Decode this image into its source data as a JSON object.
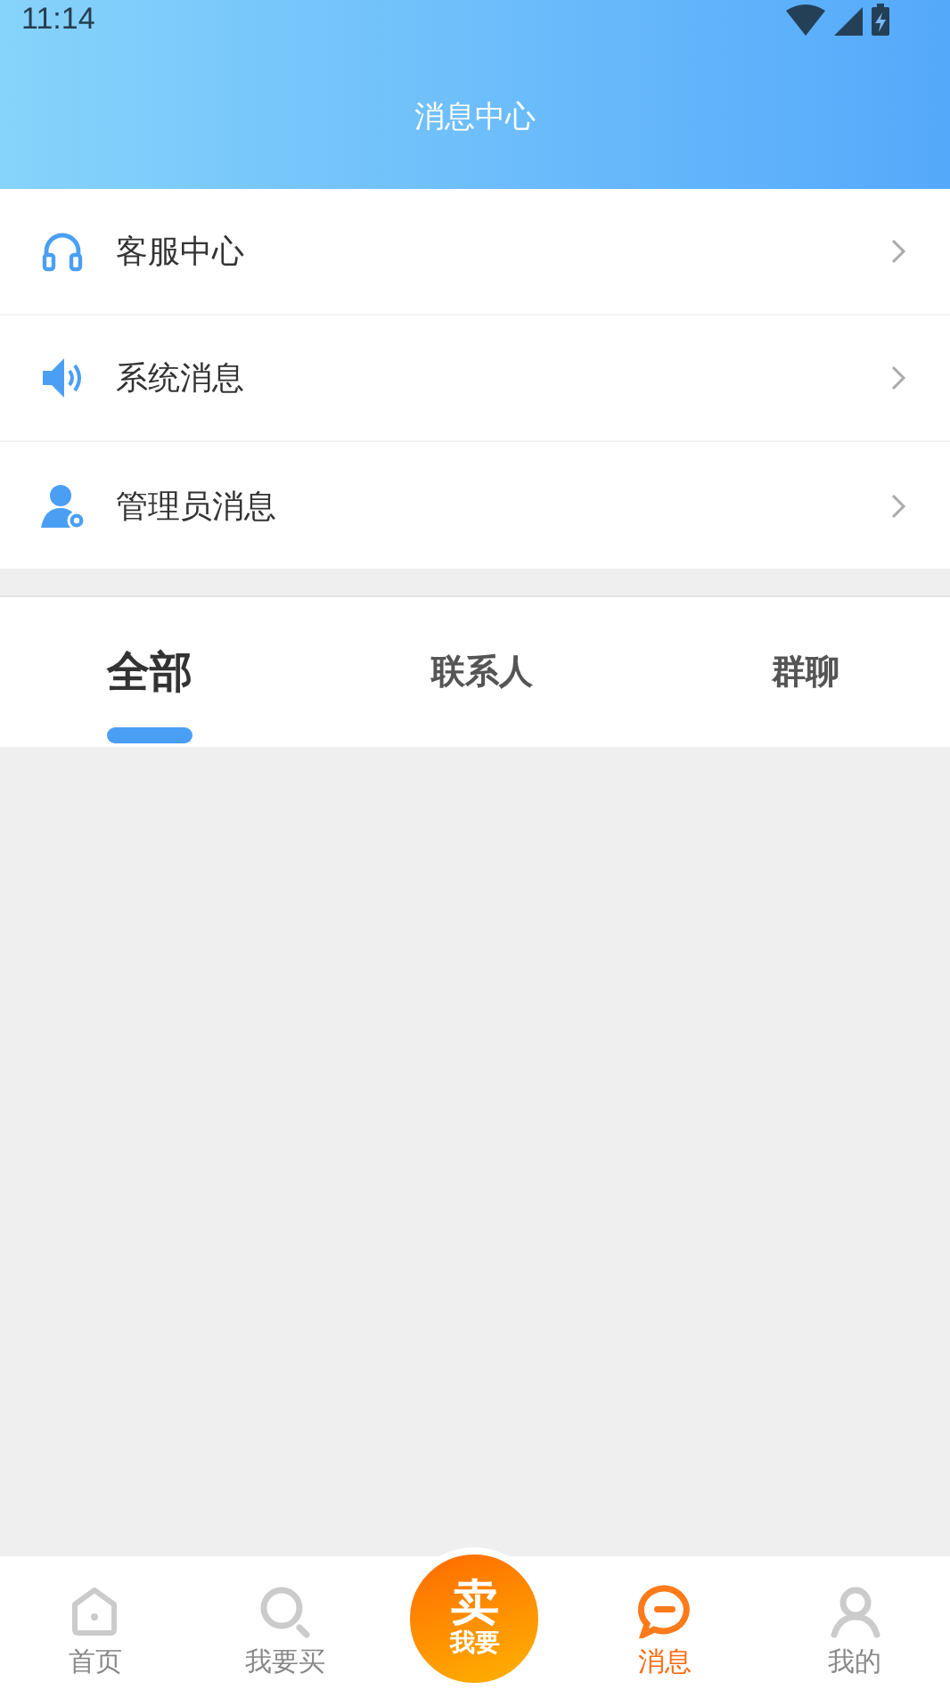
{
  "status_bar": {
    "time": "11:14"
  },
  "header": {
    "title": "消息中心"
  },
  "menu": [
    {
      "kind": "headset",
      "label": "客服中心"
    },
    {
      "kind": "speaker",
      "label": "系统消息"
    },
    {
      "kind": "admin",
      "label": "管理员消息"
    }
  ],
  "tabs": [
    {
      "label": "全部",
      "selected": true
    },
    {
      "label": "联系人",
      "selected": false
    },
    {
      "label": "群聊",
      "selected": false
    }
  ],
  "nav": [
    {
      "kind": "home",
      "label": "首页",
      "selected": false
    },
    {
      "kind": "search",
      "label": "我要买",
      "selected": false
    },
    {
      "kind": "sell",
      "big": "卖",
      "small": "我要"
    },
    {
      "kind": "chat",
      "label": "消息",
      "selected": true
    },
    {
      "kind": "user",
      "label": "我的",
      "selected": false
    }
  ]
}
